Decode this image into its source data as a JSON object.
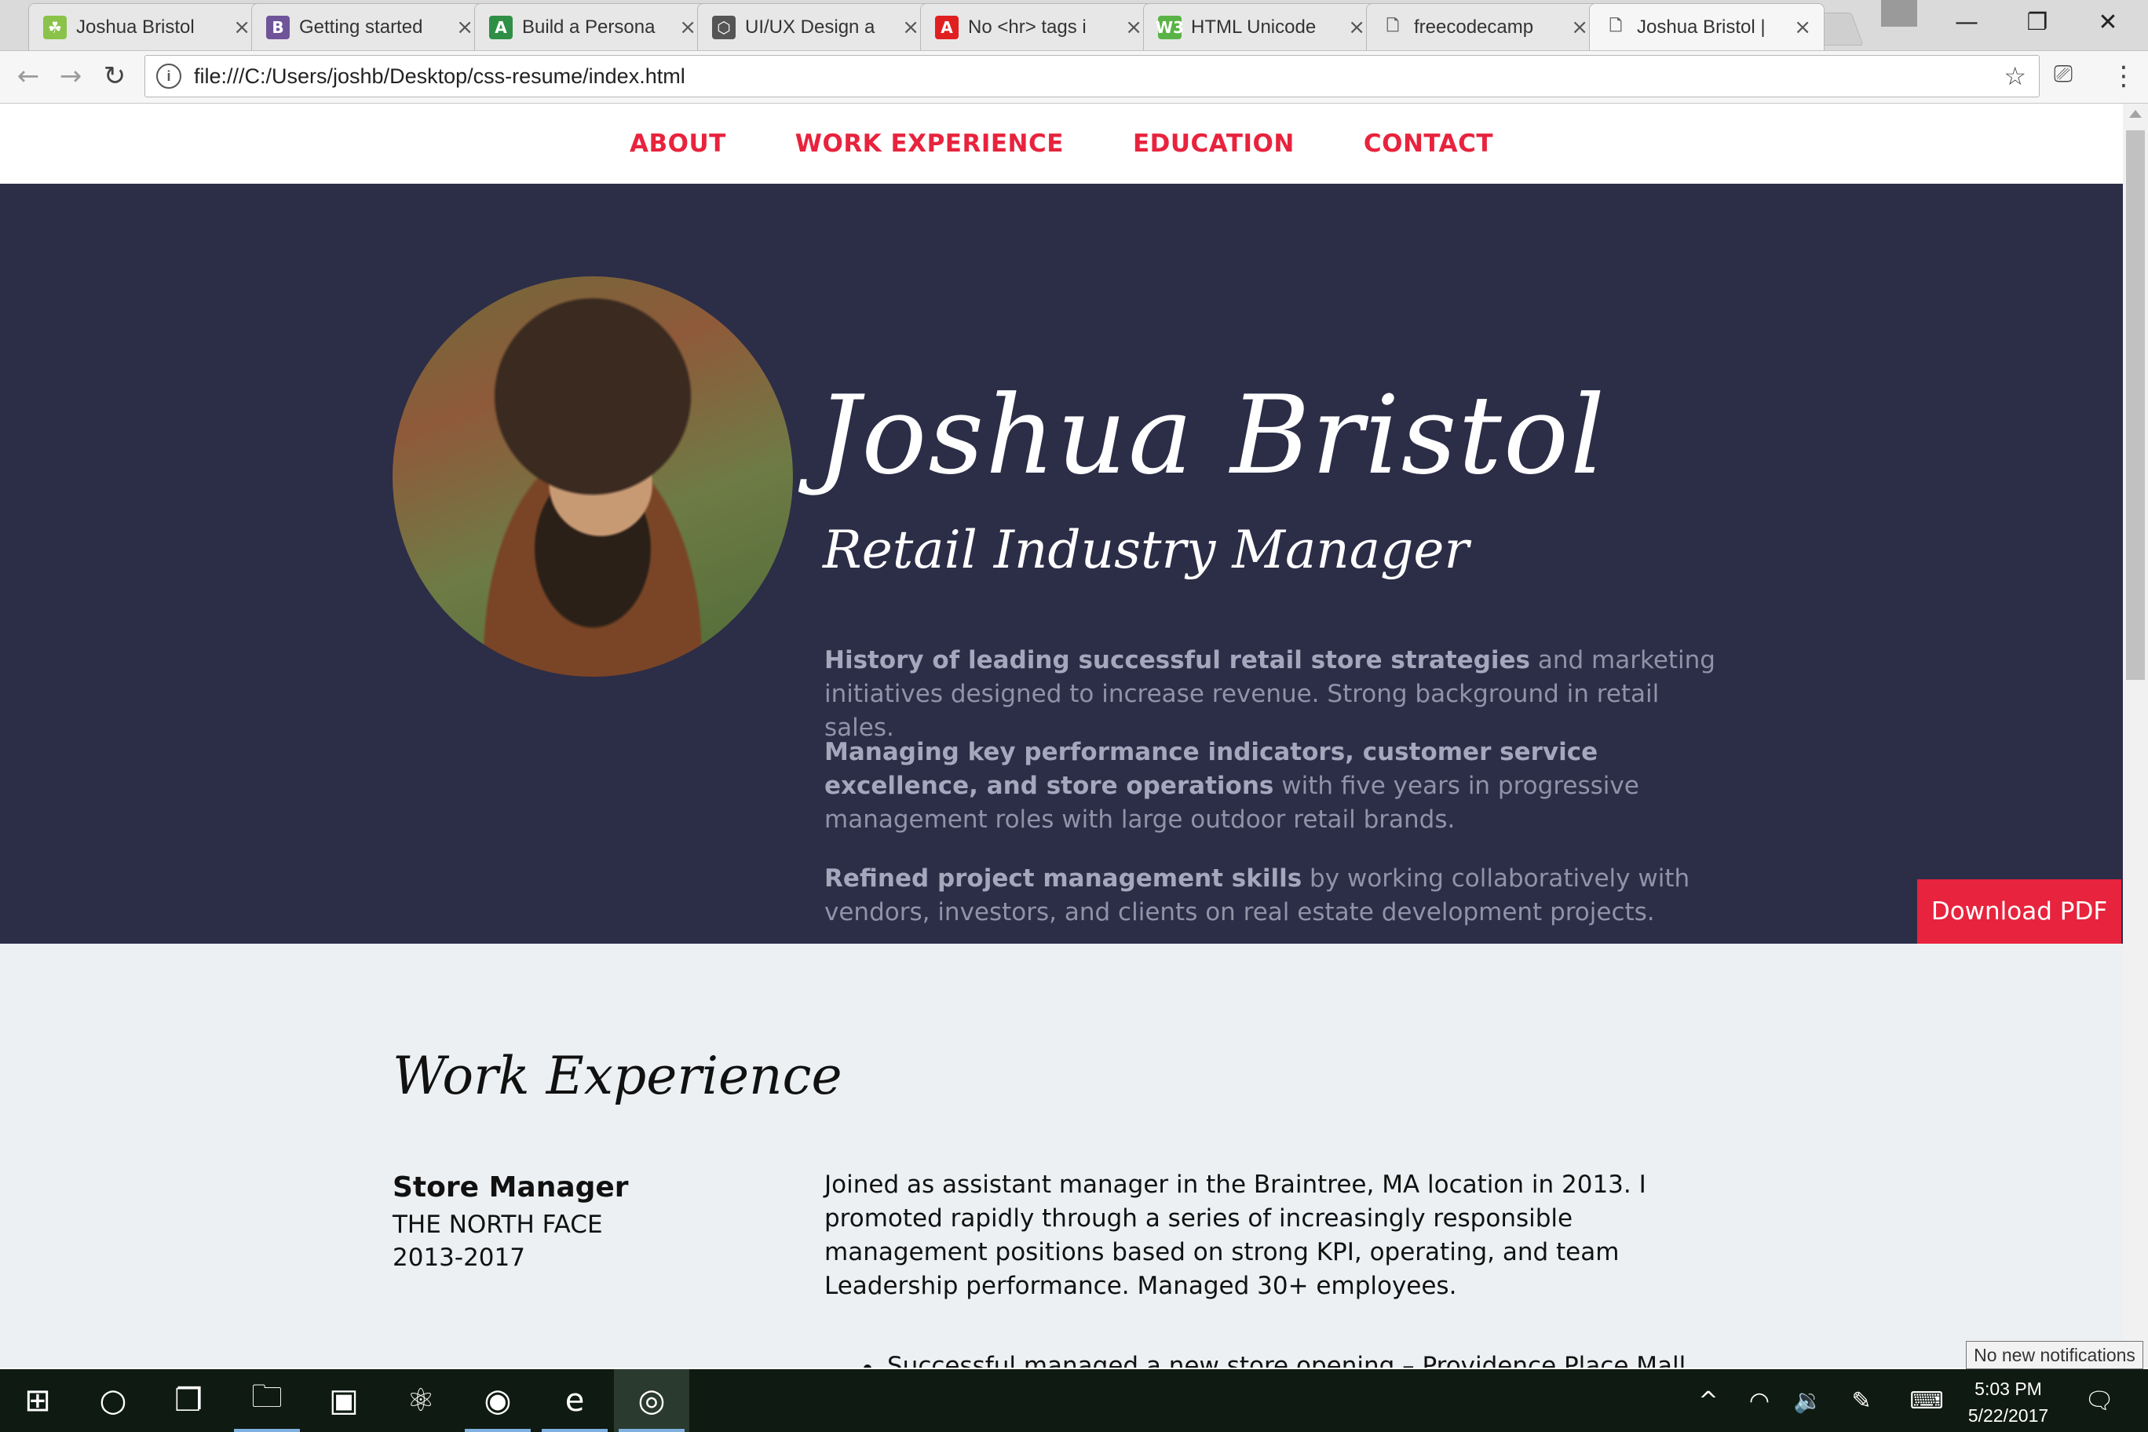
{
  "browser": {
    "tabs": [
      {
        "title": "Joshua Bristol",
        "icon": "android-icon",
        "color": "#8bc34a",
        "glyph": "☘"
      },
      {
        "title": "Getting started",
        "icon": "bootstrap-icon",
        "color": "#6f5499",
        "glyph": "B"
      },
      {
        "title": "Build a Persona",
        "icon": "codepen-green-icon",
        "color": "#2f8f46",
        "glyph": "A"
      },
      {
        "title": "UI/UX Design a",
        "icon": "codepen-icon",
        "color": "#555555",
        "glyph": "⬡"
      },
      {
        "title": "No <hr> tags i",
        "icon": "adobe-icon",
        "color": "#e02020",
        "glyph": "A"
      },
      {
        "title": "HTML Unicode",
        "icon": "unicode-icon",
        "color": "#5ab347",
        "glyph": "W3"
      },
      {
        "title": "freecodecamp",
        "icon": "page-icon",
        "color": "#ffffff",
        "glyph": "🗋"
      },
      {
        "title": "Joshua Bristol |",
        "icon": "page-icon",
        "color": "#ffffff",
        "glyph": "🗋"
      }
    ],
    "close_glyph": "×",
    "window_controls": {
      "minimize": "—",
      "maximize": "❐",
      "close": "✕"
    },
    "url": "file:///C:/Users/joshb/Desktop/css-resume/index.html",
    "info_glyph": "i",
    "star_glyph": "☆",
    "back_glyph": "←",
    "forward_glyph": "→",
    "reload_glyph": "↻",
    "cast_glyph": "⎚",
    "menu_glyph": "⋮"
  },
  "site": {
    "nav": [
      "ABOUT",
      "WORK EXPERIENCE",
      "EDUCATION",
      "CONTACT"
    ],
    "name": "Joshua Bristol",
    "headline": "Retail Industry Manager",
    "bio": [
      {
        "bold": "History of leading successful retail store strategies",
        "rest": " and marketing initiatives designed to increase revenue. Strong background in retail sales."
      },
      {
        "bold": "Managing key performance indicators, customer service excellence, and store operations",
        "rest": " with five years in progressive management roles with large outdoor retail brands."
      },
      {
        "bold": "Refined project management skills",
        "rest": " by working collaboratively with vendors, investors, and clients on real estate development projects."
      }
    ],
    "download_label": "Download PDF",
    "work_heading": "Work Experience",
    "job": {
      "title": "Store Manager",
      "company": "THE NORTH FACE",
      "years": "2013-2017",
      "description": "Joined as assistant manager in the Braintree, MA location in 2013. I promoted rapidly through a series of increasingly responsible management positions based on strong KPI, operating, and team Leadership performance. Managed 30+ employees.",
      "bullet": "Successful managed a new store opening – Providence Place Mall"
    },
    "colors": {
      "accent": "#e8233d",
      "hero_bg": "#2c2d47",
      "work_bg": "#ecf0f2",
      "bio_text": "#8f94a9"
    }
  },
  "taskbar": {
    "apps": [
      {
        "name": "start-icon",
        "glyph": "⊞"
      },
      {
        "name": "cortana-icon",
        "glyph": "○"
      },
      {
        "name": "task-view-icon",
        "glyph": "❐"
      },
      {
        "name": "file-explorer-icon",
        "glyph": "🗀"
      },
      {
        "name": "app-icon",
        "glyph": "▣"
      },
      {
        "name": "atom-icon",
        "glyph": "⚛"
      },
      {
        "name": "firefox-icon",
        "glyph": "◉"
      },
      {
        "name": "edge-icon",
        "glyph": "e"
      },
      {
        "name": "chrome-icon",
        "glyph": "◎"
      }
    ],
    "notification": "No new notifications",
    "time": "5:03 PM",
    "date": "5/22/2017",
    "tray": {
      "chevron": "^",
      "wifi": "◠",
      "volume": "🔉",
      "pen": "✎",
      "keyboard": "⌨",
      "action_center": "🗨"
    }
  }
}
